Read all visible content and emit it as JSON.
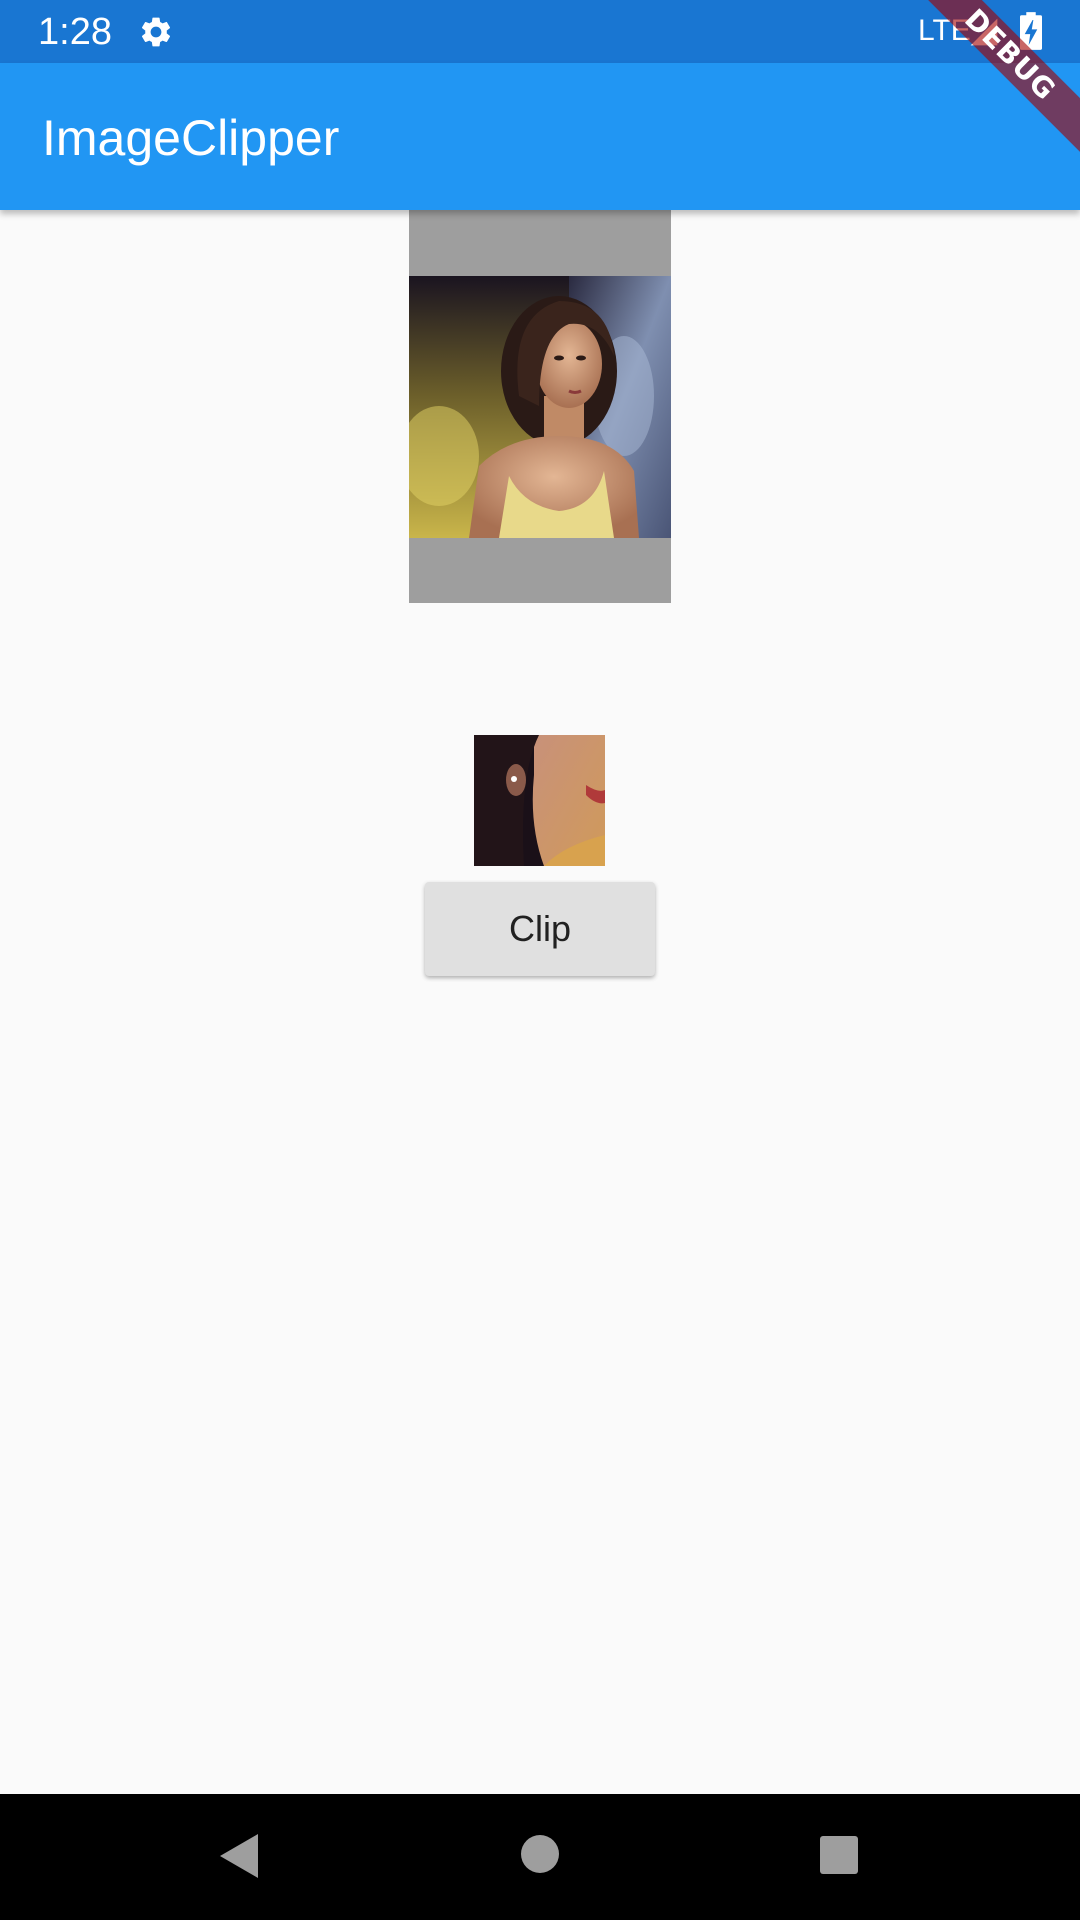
{
  "status_bar": {
    "time": "1:28",
    "network": "LTE",
    "icons": [
      "gear-icon",
      "signal-icon",
      "battery-charging-icon"
    ]
  },
  "app_bar": {
    "title": "ImageClipper"
  },
  "debug_banner": {
    "label": "DEBUG"
  },
  "main": {
    "clip_button_label": "Clip"
  },
  "nav_bar": {
    "icons": [
      "back-icon",
      "home-icon",
      "recents-icon"
    ]
  },
  "colors": {
    "status_bar": "#1976d2",
    "app_bar": "#2196f3",
    "background": "#fafafa",
    "image_frame": "#9e9e9e",
    "button": "#e0e0e0",
    "nav_bar": "#000000"
  }
}
